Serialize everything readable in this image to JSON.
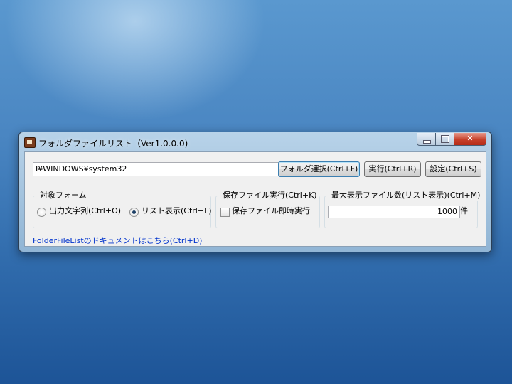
{
  "window": {
    "title": "フォルダファイルリスト（Ver1.0.0.0)",
    "app_icon": "app-icon",
    "controls": {
      "minimize_icon": "minimize-icon",
      "maximize_icon": "maximize-icon",
      "close_glyph": "✕"
    }
  },
  "path": {
    "value": "I¥WINDOWS¥system32"
  },
  "buttons": {
    "folder_select": "フォルダ選択(Ctrl+F)",
    "run": "実行(Ctrl+R)",
    "settings": "設定(Ctrl+S)"
  },
  "target_group": {
    "legend": "対象フォーム",
    "option_output": "出力文字列(Ctrl+O)",
    "option_list": "リスト表示(Ctrl+L)",
    "selected": "option_list"
  },
  "save_group": {
    "legend": "保存ファイル実行(Ctrl+K)",
    "checkbox_label": "保存ファイル即時実行",
    "checked": false
  },
  "max_group": {
    "legend": "最大表示ファイル数(リスト表示)(Ctrl+M)",
    "value": "1000",
    "unit": "件"
  },
  "doc_link": "FolderFileListのドキュメントはこちら(Ctrl+D)"
}
